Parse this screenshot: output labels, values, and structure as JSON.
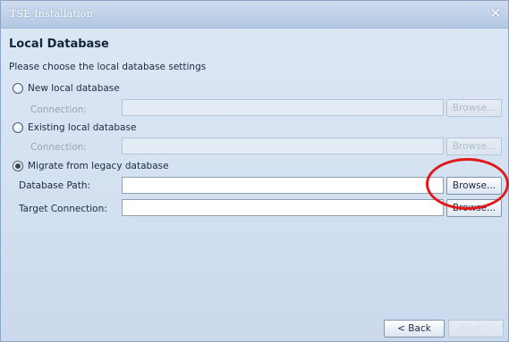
{
  "window": {
    "title": "TSE Installation",
    "close_glyph": "✕"
  },
  "page": {
    "title": "Local Database",
    "instructions": "Please choose the local database settings"
  },
  "options": {
    "new_db": {
      "label": "New local database",
      "selected": false,
      "connection_label": "Connection:",
      "connection_value": "",
      "browse_label": "Browse..."
    },
    "existing_db": {
      "label": "Existing local database",
      "selected": false,
      "connection_label": "Connection:",
      "connection_value": "",
      "browse_label": "Browse..."
    },
    "migrate_db": {
      "label": "Migrate from legacy database",
      "selected": true,
      "path_label": "Database Path:",
      "path_value": "",
      "path_browse_label": "Browse...",
      "target_label": "Target Connection:",
      "target_value": "",
      "target_browse_label": "Browse..."
    }
  },
  "footer": {
    "back_label": "< Back",
    "next_label": "Next >"
  },
  "colors": {
    "annotation": "#e01a1a",
    "background": "#d3e0f0"
  }
}
